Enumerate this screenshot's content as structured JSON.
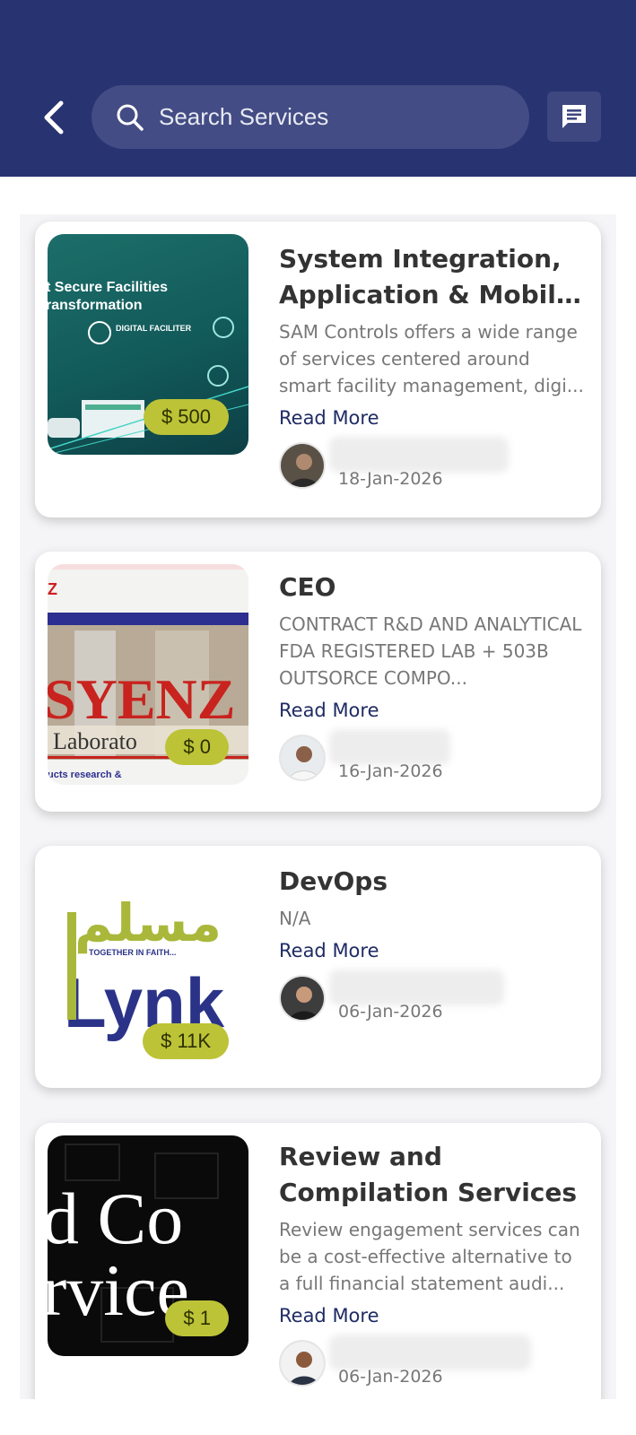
{
  "header": {
    "search_placeholder": "Search Services",
    "icons": {
      "back": "chevron-left-icon",
      "search": "search-icon",
      "chat": "chat-icon"
    },
    "colors": {
      "bar": "#283371",
      "search_bg": "#434c84"
    }
  },
  "services": [
    {
      "title": "System Integration, Application & Mobile ...",
      "description": "SAM Controls offers a wide range of services centered around smart facility management, digi...",
      "read_more": "Read More",
      "price": "$ 500",
      "date": "18-Jan-2026",
      "thumb_text": [
        "t Secure Facilities",
        "ransformation",
        "DIGITAL FACILITER"
      ]
    },
    {
      "title": "CEO",
      "description": "CONTRACT R&D AND ANALYTICAL FDA REGISTERED LAB + 503B OUTSORCE COMPO...",
      "read_more": "Read More",
      "price": "$ 0",
      "date": "16-Jan-2026",
      "thumb_text": [
        "SYENZ",
        "Laborato",
        "ucts research &"
      ]
    },
    {
      "title": "DevOps",
      "description": "N/A",
      "read_more": "Read More",
      "price": "$ 11K",
      "date": "06-Jan-2026",
      "thumb_text": [
        "مسلم",
        "TOGETHER IN FAITH...",
        "Lynk"
      ]
    },
    {
      "title": "Review and Compilation Services",
      "description": "Review engagement services can be a cost-effective alternative to a full financial statement audi...",
      "read_more": "Read More",
      "price": "$ 1",
      "date": "06-Jan-2026",
      "thumb_text": [
        "d Co",
        "rvice"
      ]
    }
  ],
  "colors": {
    "price_badge": "#bcc337",
    "link": "#1f2b63"
  }
}
